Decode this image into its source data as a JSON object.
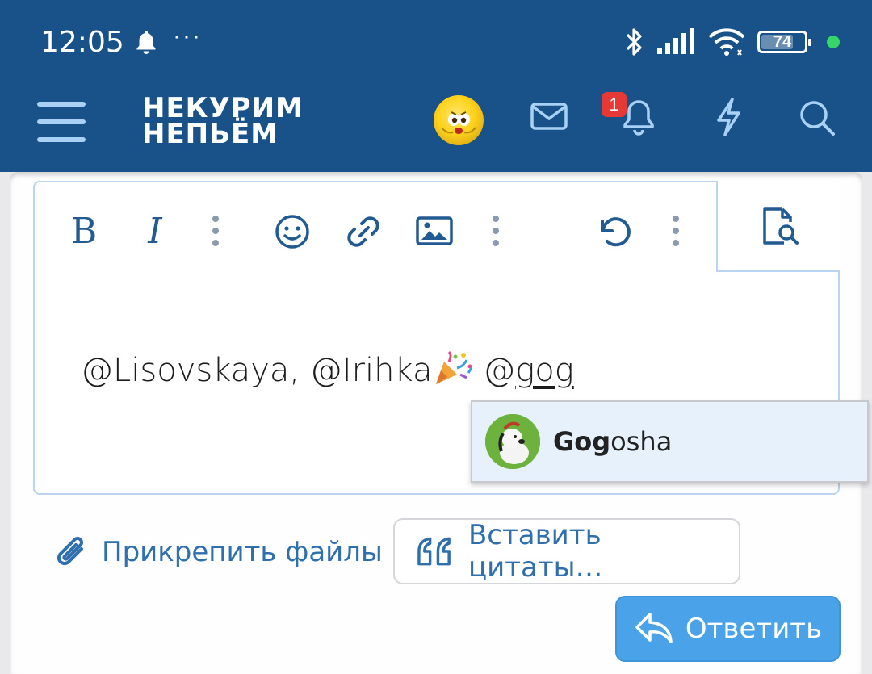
{
  "status_bar": {
    "time": "12:05",
    "dots": "···",
    "battery": "74",
    "battery_level_percent": 74
  },
  "header": {
    "logo_line1": "НЕКУРИМ",
    "logo_line2": "НЕПЬЁМ",
    "notifications_count": "1",
    "colors": {
      "background": "#185288",
      "badge": "#e53935"
    }
  },
  "toolbar": {
    "bold": "B",
    "italic": "I",
    "icons": [
      "bold-icon",
      "italic-icon",
      "more-icon",
      "smiley-icon",
      "link-icon",
      "image-icon",
      "more-icon",
      "undo-icon",
      "more-icon",
      "preview-icon"
    ]
  },
  "editor": {
    "text_before": "@Lisovskaya, @Irihka",
    "text_after_emoji": " @",
    "text_underlined": "gog",
    "emoji": "party-popper"
  },
  "mention_popup": {
    "match_bold": "Gog",
    "match_rest": "osha"
  },
  "actions": {
    "attach_label": "Прикрепить файлы",
    "insert_quotes_label": "Вставить цитаты…",
    "reply_label": "Ответить",
    "colors": {
      "link": "#2f6fae",
      "reply_bg": "#4aa3e8"
    }
  }
}
